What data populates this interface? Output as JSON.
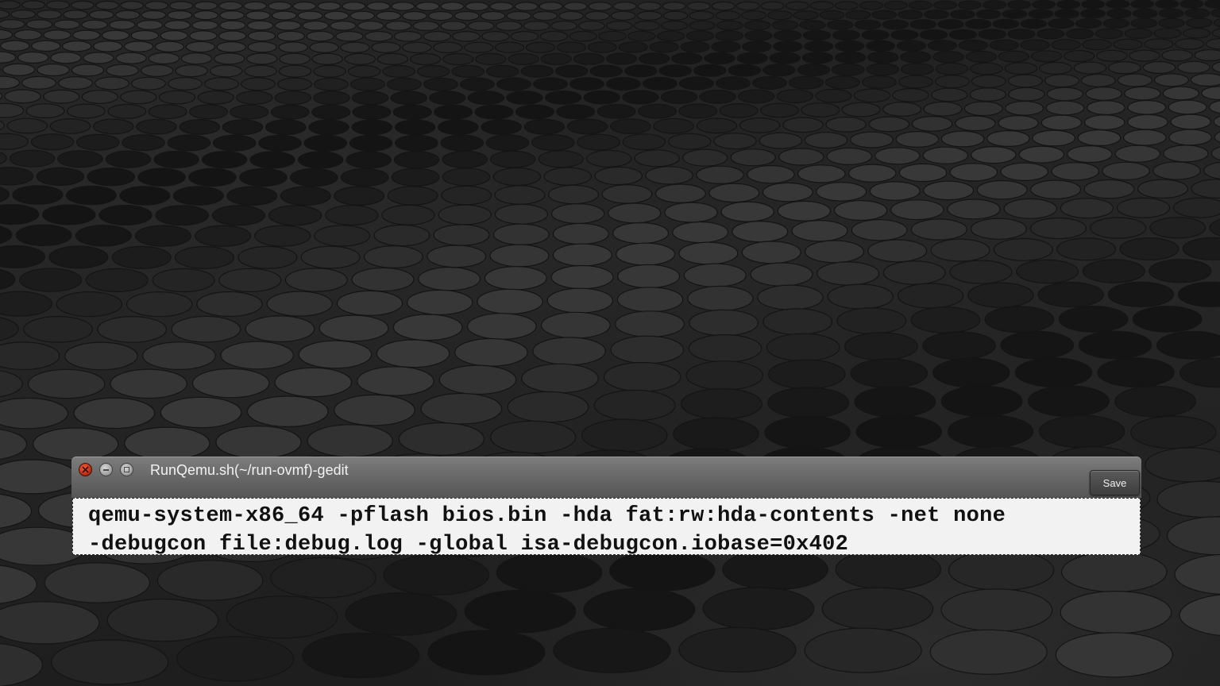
{
  "desktop": {
    "wallpaper": "dark-textured-disc-pattern"
  },
  "window": {
    "title": "RunQemu.sh(~/run-ovmf)-gedit",
    "controls": {
      "close_icon": "close-icon",
      "minimize_icon": "minimize-icon",
      "maximize_icon": "maximize-icon"
    },
    "toolbar": {
      "save_label": "Save"
    },
    "editor": {
      "lines": [
        "qemu-system-x86_64 -pflash bios.bin -hda fat:rw:hda-contents -net none",
        "-debugcon file:debug.log -global isa-debugcon.iobase=0x402"
      ]
    }
  },
  "colors": {
    "titlebar": "#6a6a6a",
    "close_button": "#c23010",
    "editor_background": "#f2f2f2",
    "text": "#111111"
  }
}
